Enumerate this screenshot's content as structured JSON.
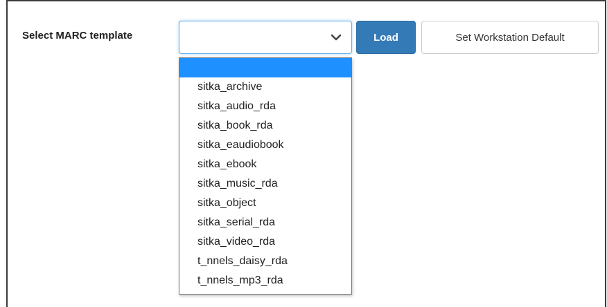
{
  "form": {
    "label": "Select MARC template",
    "select": {
      "selected_value": "",
      "options": [
        "",
        "sitka_archive",
        "sitka_audio_rda",
        "sitka_book_rda",
        "sitka_eaudiobook",
        "sitka_ebook",
        "sitka_music_rda",
        "sitka_object",
        "sitka_serial_rda",
        "sitka_video_rda",
        "t_nnels_daisy_rda",
        "t_nnels_mp3_rda"
      ],
      "highlighted_index": 0,
      "icon": "chevron-down-icon"
    },
    "load_label": "Load",
    "default_label": "Set Workstation Default"
  },
  "colors": {
    "primary_button": "#337ab7",
    "highlight": "#1e90ff",
    "focus_border": "#66afe9"
  }
}
